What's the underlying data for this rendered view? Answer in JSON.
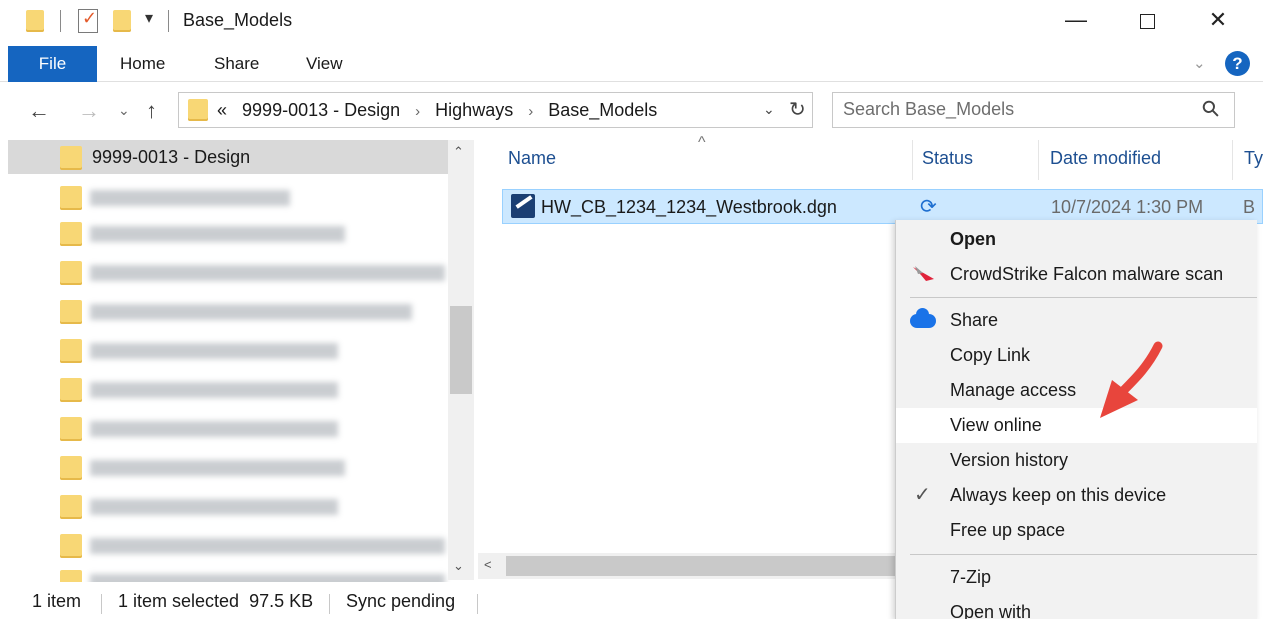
{
  "window": {
    "title": "Base_Models",
    "minimize_glyph": "—",
    "close_glyph": "✕",
    "dropdown_glyph": "▾",
    "checkmark_glyph": "✓"
  },
  "ribbon": {
    "tabs": [
      "File",
      "Home",
      "Share",
      "View"
    ],
    "chevron_glyph": "⌄",
    "help_glyph": "?"
  },
  "address": {
    "back_glyph": "←",
    "forward_glyph": "→",
    "recent_glyph": "⌄",
    "up_glyph": "↑",
    "overflow": "«",
    "crumbs": [
      "9999-0013 - Design",
      "Highways",
      "Base_Models"
    ],
    "crumb_sep": "›",
    "dropdown_glyph": "⌄",
    "refresh_glyph": "↻"
  },
  "search": {
    "placeholder": "Search Base_Models",
    "icon_glyph": "⚲"
  },
  "nav_pane": {
    "selected_item": "9999-0013 - Design",
    "scroll_up": "⌃",
    "scroll_down": "⌄",
    "blurred_count": 12
  },
  "columns": {
    "name": "Name",
    "status": "Status",
    "date_modified": "Date modified",
    "type": "Ty",
    "sort_glyph": "^"
  },
  "files": [
    {
      "name": "HW_CB_1234_1234_Westbrook.dgn",
      "status_icon": "sync-pending-icon",
      "status_glyph": "⟳",
      "date_modified": "10/7/2024 1:30 PM",
      "type": "B"
    }
  ],
  "hscroll": {
    "left_glyph": "<"
  },
  "status_bar": {
    "item_count": "1 item",
    "selected": "1 item selected  97.5 KB",
    "sync": "Sync pending"
  },
  "context_menu": {
    "open": "Open",
    "crowdstrike": "CrowdStrike Falcon malware scan",
    "share": "Share",
    "copy_link": "Copy Link",
    "manage_access": "Manage access",
    "view_online": "View online",
    "version_history": "Version history",
    "always_keep": "Always keep on this device",
    "free_up_space": "Free up space",
    "seven_zip": "7-Zip",
    "open_with": "Open with"
  },
  "colors": {
    "accent": "#1565c0",
    "selection": "#cce8ff",
    "annotation_arrow": "#e8453c"
  }
}
